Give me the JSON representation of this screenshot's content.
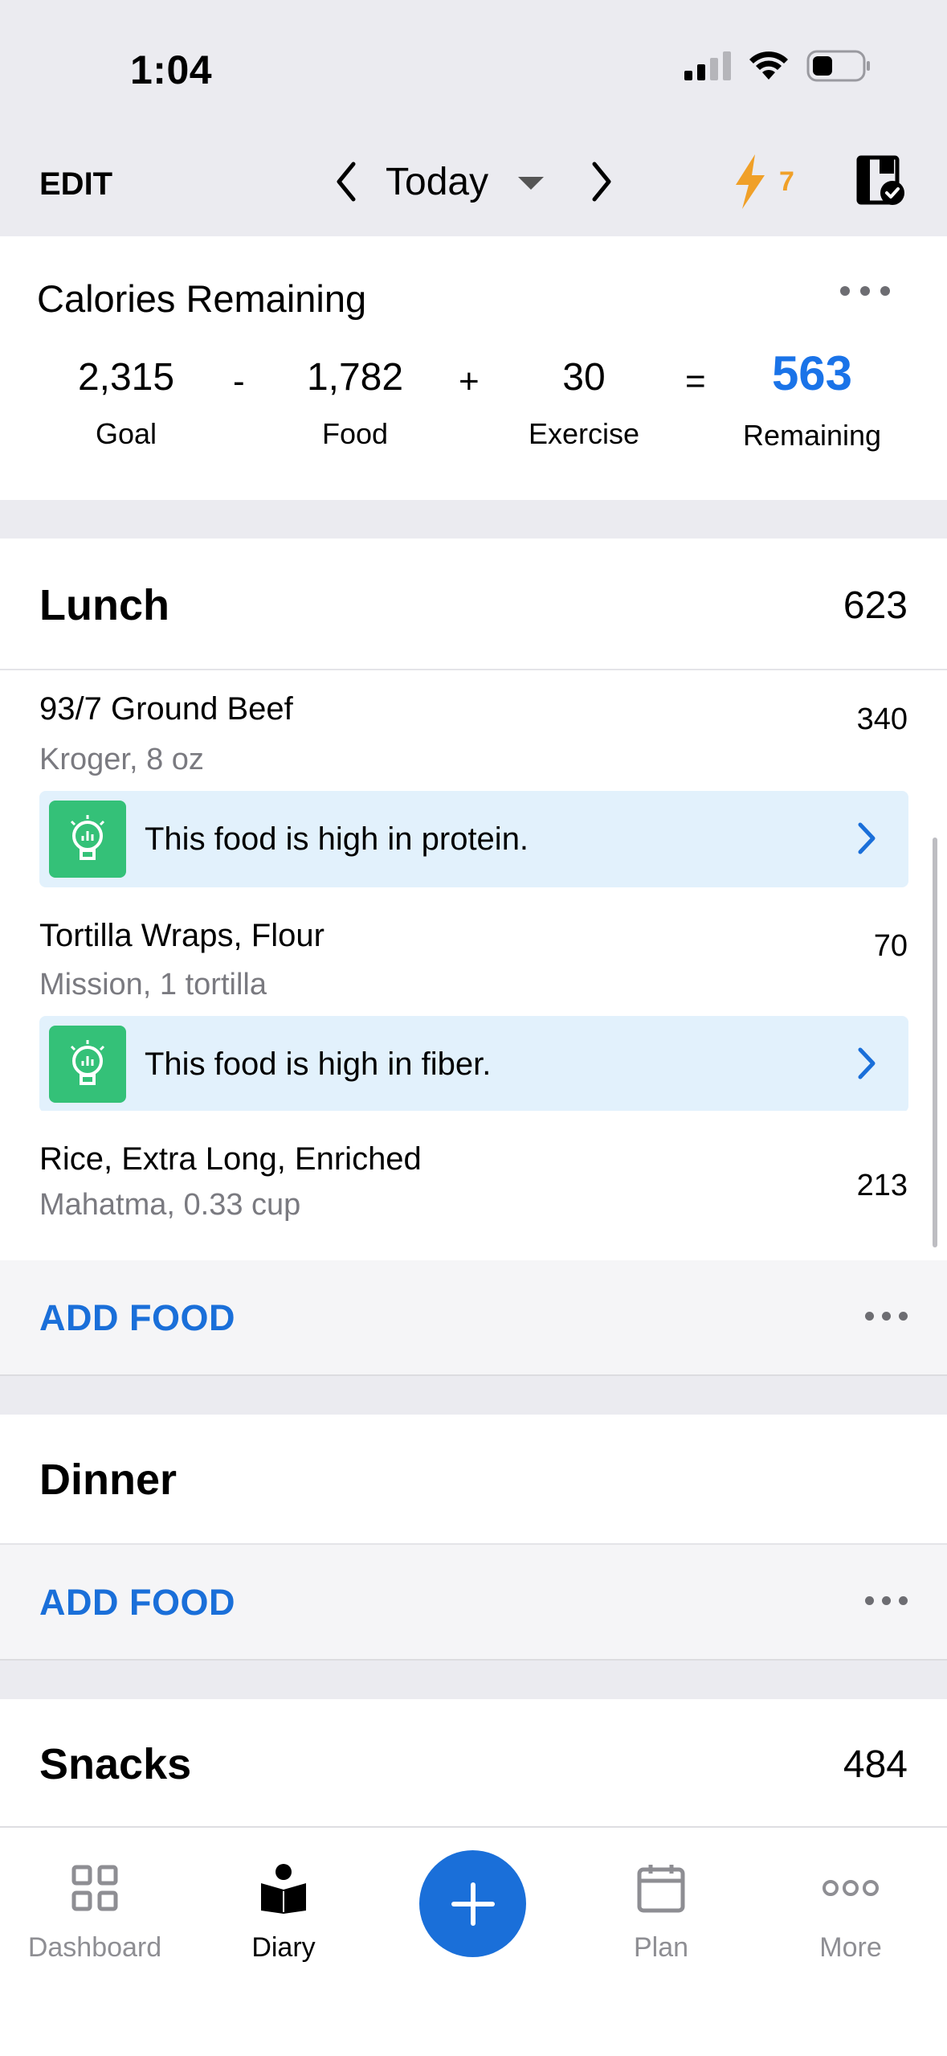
{
  "status_bar": {
    "time": "1:04"
  },
  "nav": {
    "edit_label": "EDIT",
    "date_label": "Today",
    "streak_count": "7",
    "streak_color": "#f0a028"
  },
  "calories": {
    "title": "Calories Remaining",
    "goal": {
      "value": "2,315",
      "label": "Goal"
    },
    "op_minus": "-",
    "food": {
      "value": "1,782",
      "label": "Food"
    },
    "op_plus": "+",
    "exercise": {
      "value": "30",
      "label": "Exercise"
    },
    "op_equals": "=",
    "remaining": {
      "value": "563",
      "label": "Remaining"
    },
    "accent_color": "#1a73e8"
  },
  "lunch": {
    "title": "Lunch",
    "total": "623",
    "items": [
      {
        "name": "93/7 Ground Beef",
        "desc": "Kroger, 8 oz",
        "calories": "340",
        "tip": "This food is high in protein."
      },
      {
        "name": "Tortilla Wraps, Flour",
        "desc": "Mission, 1 tortilla",
        "calories": "70",
        "tip": "This food is high in fiber."
      },
      {
        "name": "Rice, Extra Long, Enriched",
        "desc": "Mahatma, 0.33 cup",
        "calories": "213"
      }
    ],
    "add_label": "ADD FOOD"
  },
  "dinner": {
    "title": "Dinner",
    "add_label": "ADD FOOD"
  },
  "snacks": {
    "title": "Snacks",
    "total": "484"
  },
  "tabs": [
    {
      "label": "Dashboard",
      "icon": "dashboard-grid-icon"
    },
    {
      "label": "Diary",
      "icon": "diary-book-icon",
      "active": true
    },
    {
      "label": "",
      "icon": "plus-icon"
    },
    {
      "label": "Plan",
      "icon": "calendar-icon"
    },
    {
      "label": "More",
      "icon": "more-dots-icon"
    }
  ],
  "colors": {
    "link": "#1a6fd9",
    "tip_bg": "#e2f1fc",
    "tip_icon": "#34c178",
    "header_bg": "#ebebf0"
  }
}
